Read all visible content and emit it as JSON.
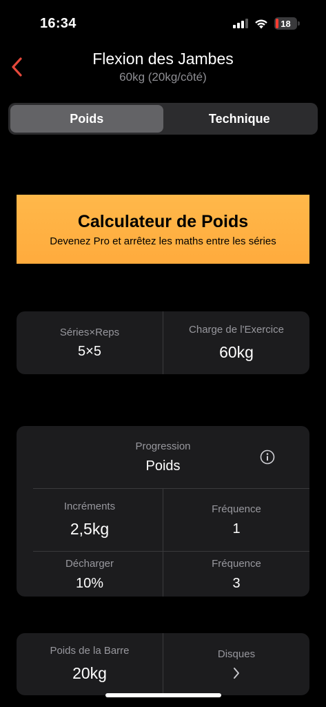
{
  "status_bar": {
    "time": "16:34",
    "battery": "18"
  },
  "header": {
    "title": "Flexion des Jambes",
    "subtitle": "60kg (20kg/côté)"
  },
  "tabs": [
    {
      "label": "Poids",
      "active": true
    },
    {
      "label": "Technique",
      "active": false
    }
  ],
  "promo": {
    "title": "Calculateur de Poids",
    "subtitle": "Devenez Pro et arrêtez les maths entre les séries"
  },
  "summary": {
    "sets_reps_label": "Séries×Reps",
    "sets_reps_value": "5×5",
    "load_label": "Charge de l'Exercice",
    "load_value": "60kg"
  },
  "progression": {
    "label": "Progression",
    "value": "Poids",
    "increments_label": "Incréments",
    "increments_value": "2,5kg",
    "frequency1_label": "Fréquence",
    "frequency1_value": "1",
    "deload_label": "Décharger",
    "deload_value": "10%",
    "frequency2_label": "Fréquence",
    "frequency2_value": "3"
  },
  "bar": {
    "bar_weight_label": "Poids de la Barre",
    "bar_weight_value": "20kg",
    "plates_label": "Disques"
  },
  "colors": {
    "accent_red": "#e5483b",
    "promo_orange": "#ffb84a",
    "card_bg": "#1c1c1e"
  },
  "icons": [
    "chevron-left-icon",
    "info-icon",
    "chevron-right-icon",
    "wifi-icon",
    "signal-icon",
    "battery-icon"
  ]
}
